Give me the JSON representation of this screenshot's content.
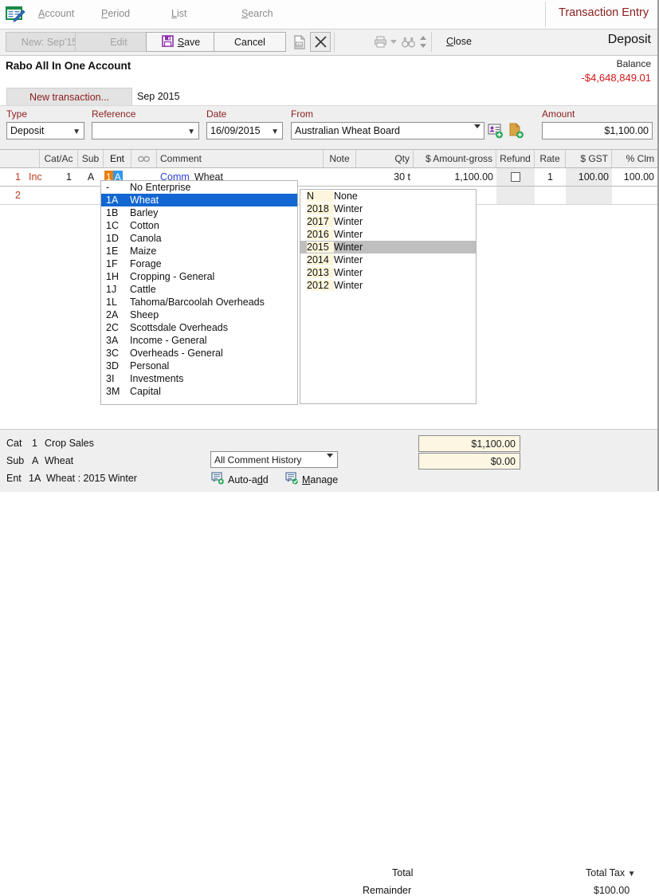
{
  "menubar": {
    "app_icon": "form-pencil-icon",
    "items": [
      {
        "label": "Account",
        "accel": "A"
      },
      {
        "label": "Period",
        "accel": "P"
      },
      {
        "label": "List",
        "accel": "L"
      },
      {
        "label": "Search",
        "accel": "S"
      }
    ],
    "mode_title": "Transaction Entry"
  },
  "toolbar": {
    "new_label": "New: Sep'15",
    "edit_label": "Edit",
    "save_label": "Save",
    "cancel_label": "Cancel",
    "attach_icon": "attach-image-icon",
    "delete_icon": "delete-x-icon",
    "print_icon": "printer-icon",
    "find_icon": "binoculars-icon",
    "close_label": "Close",
    "transaction_type": "Deposit"
  },
  "account": {
    "name": "Rabo All In One Account",
    "balance_label": "Balance",
    "balance_value": "-$4,648,849.01"
  },
  "tabs": [
    {
      "label": "New transaction...",
      "active": true
    },
    {
      "label": "Sep 2015",
      "active": false
    }
  ],
  "fields": {
    "type": {
      "label": "Type",
      "value": "Deposit"
    },
    "reference": {
      "label": "Reference",
      "value": ""
    },
    "date": {
      "label": "Date",
      "value": "16/09/2015"
    },
    "from": {
      "label": "From",
      "value": "Australian Wheat Board"
    },
    "amount": {
      "label": "Amount",
      "value": "$1,100.00"
    },
    "add_contact_icon": "add-contact-icon",
    "add_document_icon": "add-document-icon"
  },
  "grid": {
    "columns": [
      "",
      "",
      "Cat/Ac",
      "Sub",
      "Ent",
      "link-icon",
      "Comment",
      "Note",
      "Qty",
      "$ Amount-gross",
      "Refund",
      "Rate",
      "$ GST",
      "% Clm"
    ],
    "rows": [
      {
        "num": "1",
        "kind": "Inc",
        "catac": "1",
        "sub": "A",
        "ent_code": "1",
        "ent_sub": "A",
        "comment_link": "Comm",
        "comment": "Wheat",
        "note": "",
        "qty": "30 t",
        "amount_gross": "1,100.00",
        "refund": false,
        "rate": "1",
        "gst": "100.00",
        "clm": "100.00"
      },
      {
        "num": "2",
        "kind": "",
        "catac": "",
        "sub": "",
        "ent_code": "",
        "ent_sub": "",
        "comment_link": "",
        "comment": "",
        "note": "",
        "qty": "",
        "amount_gross": "",
        "refund": false,
        "rate": "",
        "gst": "",
        "clm": ""
      }
    ]
  },
  "enterprise_dropdown": {
    "items": [
      {
        "code": "-",
        "label": "No Enterprise",
        "selected": false
      },
      {
        "code": "1A",
        "label": "Wheat",
        "selected": true
      },
      {
        "code": "1B",
        "label": "Barley",
        "selected": false
      },
      {
        "code": "1C",
        "label": "Cotton",
        "selected": false
      },
      {
        "code": "1D",
        "label": "Canola",
        "selected": false
      },
      {
        "code": "1E",
        "label": "Maize",
        "selected": false
      },
      {
        "code": "1F",
        "label": "Forage",
        "selected": false
      },
      {
        "code": "1H",
        "label": "Cropping - General",
        "selected": false
      },
      {
        "code": "1J",
        "label": "Cattle",
        "selected": false
      },
      {
        "code": "1L",
        "label": "Tahoma/Barcoolah Overheads",
        "selected": false
      },
      {
        "code": "2A",
        "label": "Sheep",
        "selected": false
      },
      {
        "code": "2C",
        "label": "Scottsdale Overheads",
        "selected": false
      },
      {
        "code": "3A",
        "label": "Income - General",
        "selected": false
      },
      {
        "code": "3C",
        "label": "Overheads - General",
        "selected": false
      },
      {
        "code": "3D",
        "label": "Personal",
        "selected": false
      },
      {
        "code": "3I",
        "label": "Investments",
        "selected": false
      },
      {
        "code": "3M",
        "label": "Capital",
        "selected": false
      }
    ]
  },
  "season_dropdown": {
    "items": [
      {
        "code": "N",
        "label": "None",
        "selected": false
      },
      {
        "code": "2018",
        "label": "Winter",
        "selected": false
      },
      {
        "code": "2017",
        "label": "Winter",
        "selected": false
      },
      {
        "code": "2016",
        "label": "Winter",
        "selected": false
      },
      {
        "code": "2015",
        "label": "Winter",
        "selected": true
      },
      {
        "code": "2014",
        "label": "Winter",
        "selected": false
      },
      {
        "code": "2013",
        "label": "Winter",
        "selected": false
      },
      {
        "code": "2012",
        "label": "Winter",
        "selected": false
      }
    ]
  },
  "bottom": {
    "cat": {
      "label": "Cat",
      "code": "1",
      "value": "Crop Sales"
    },
    "sub": {
      "label": "Sub",
      "code": "A",
      "value": "Wheat"
    },
    "ent": {
      "label": "Ent",
      "code": "1A",
      "value": "Wheat : 2015 Winter"
    },
    "comment_history": "All Comment History",
    "auto_add_label": "Auto-add",
    "manage_label": "Manage",
    "total_label": "Total",
    "total_value": "$1,100.00",
    "remainder_label": "Remainder",
    "remainder_value": "$0.00",
    "total_tax_label": "Total Tax",
    "total_tax_value": "$100.00",
    "auto_add_icon": "comment-add-icon",
    "manage_icon": "comment-check-icon"
  },
  "colors": {
    "accent_red": "#8b2020",
    "negative": "#d41616",
    "selection_blue": "#1267d2",
    "selection_gray": "#bfbfbf",
    "ent_orange": "#e8800c",
    "ent_blue": "#3399e8",
    "link_blue": "#2a3fd0"
  }
}
